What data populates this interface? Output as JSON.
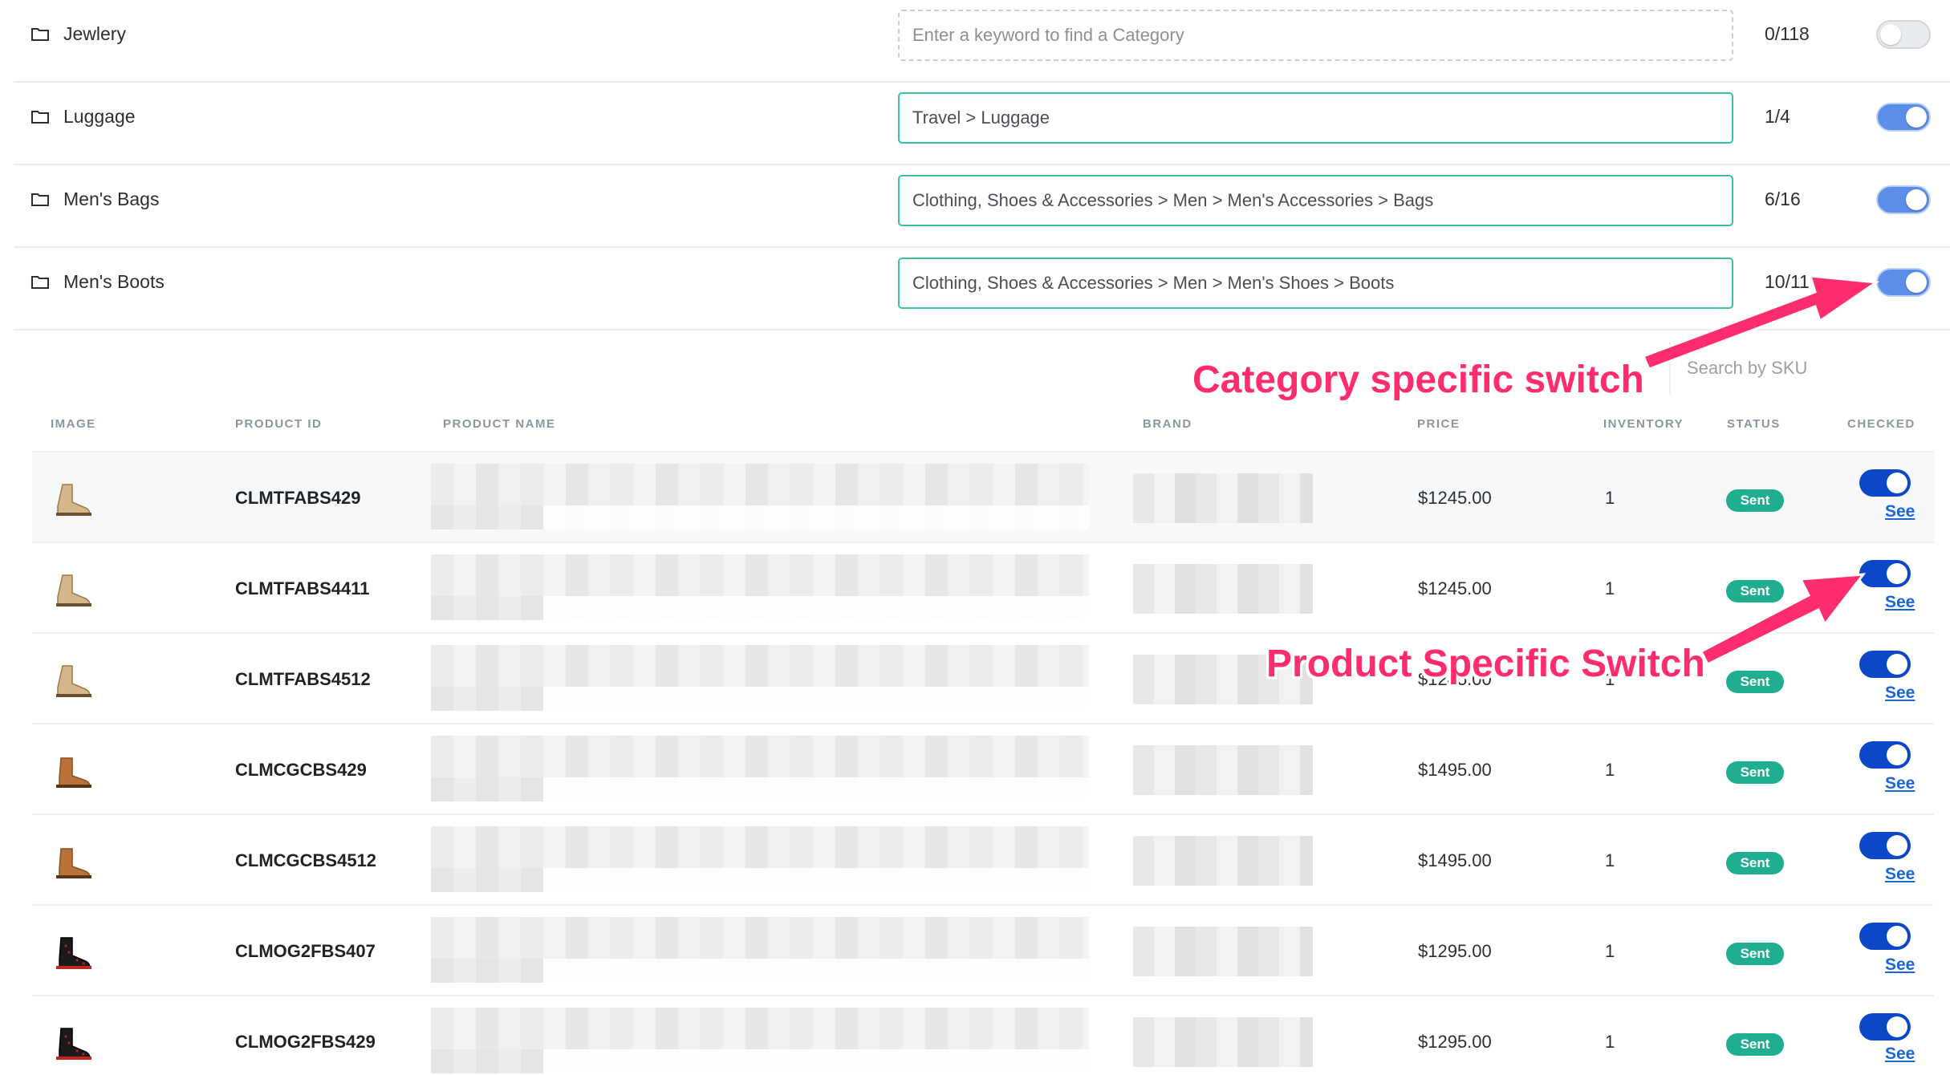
{
  "categories": [
    {
      "name": "Jewlery",
      "input_value": "",
      "placeholder": "Enter a keyword to find a Category",
      "count": "0/118",
      "enabled": false
    },
    {
      "name": "Luggage",
      "input_value": "Travel > Luggage",
      "placeholder": "",
      "count": "1/4",
      "enabled": true
    },
    {
      "name": "Men's Bags",
      "input_value": "Clothing, Shoes & Accessories > Men > Men's Accessories > Bags",
      "placeholder": "",
      "count": "6/16",
      "enabled": true
    },
    {
      "name": "Men's Boots",
      "input_value": "Clothing, Shoes & Accessories > Men > Men's Shoes > Boots",
      "placeholder": "",
      "count": "10/11",
      "enabled": true
    }
  ],
  "search": {
    "placeholder": "Search by SKU"
  },
  "table": {
    "headers": {
      "image": "IMAGE",
      "product_id": "PRODUCT ID",
      "product_name": "PRODUCT NAME",
      "brand": "BRAND",
      "price": "PRICE",
      "inventory": "INVENTORY",
      "status": "STATUS",
      "checked": "CHECKED"
    },
    "rows": [
      {
        "image": "beige-boot-icon",
        "product_id": "CLMTFABS429",
        "price": "$1245.00",
        "inventory": "1",
        "status": "Sent",
        "checked": true,
        "see": "See"
      },
      {
        "image": "beige-boot-icon",
        "product_id": "CLMTFABS4411",
        "price": "$1245.00",
        "inventory": "1",
        "status": "Sent",
        "checked": true,
        "see": "See"
      },
      {
        "image": "beige-boot-icon",
        "product_id": "CLMTFABS4512",
        "price": "$1245.00",
        "inventory": "1",
        "status": "Sent",
        "checked": true,
        "see": "See"
      },
      {
        "image": "tan-chelsea-boot-icon",
        "product_id": "CLMCGCBS429",
        "price": "$1495.00",
        "inventory": "1",
        "status": "Sent",
        "checked": true,
        "see": "See"
      },
      {
        "image": "tan-chelsea-boot-icon",
        "product_id": "CLMCGCBS4512",
        "price": "$1495.00",
        "inventory": "1",
        "status": "Sent",
        "checked": true,
        "see": "See"
      },
      {
        "image": "black-spiked-boot-icon",
        "product_id": "CLMOG2FBS407",
        "price": "$1295.00",
        "inventory": "1",
        "status": "Sent",
        "checked": true,
        "see": "See"
      },
      {
        "image": "black-spiked-boot-icon",
        "product_id": "CLMOG2FBS429",
        "price": "$1295.00",
        "inventory": "1",
        "status": "Sent",
        "checked": true,
        "see": "See"
      }
    ]
  },
  "annotations": {
    "category_switch": "Category specific switch",
    "product_switch": "Product Specific Switch"
  },
  "colors": {
    "accent_teal": "#3cbfa6",
    "toggle_blue": "#5c8ee9",
    "product_toggle_blue": "#0d47c9",
    "status_green": "#1fae8f",
    "annotation_pink": "#ff2d6d",
    "link_blue": "#1a66d9"
  }
}
